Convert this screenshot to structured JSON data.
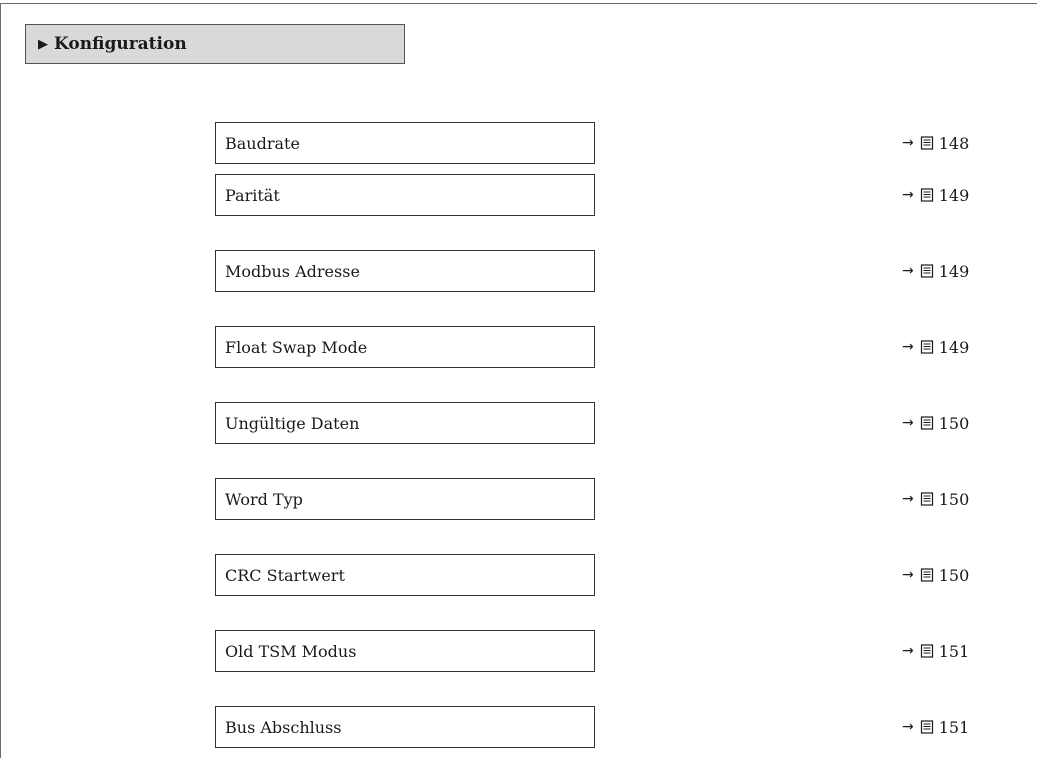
{
  "section": {
    "title": "Konfiguration",
    "expand_icon": "right-triangle-icon"
  },
  "parameters": [
    {
      "label": "Baudrate",
      "page": "148"
    },
    {
      "label": "Parität",
      "page": "149"
    },
    {
      "label": "Modbus Adresse",
      "page": "149"
    },
    {
      "label": "Float Swap Mode",
      "page": "149"
    },
    {
      "label": "Ungültige Daten",
      "page": "150"
    },
    {
      "label": "Word Typ",
      "page": "150"
    },
    {
      "label": "CRC Startwert",
      "page": "150"
    },
    {
      "label": "Old TSM Modus",
      "page": "151"
    },
    {
      "label": "Bus Abschluss",
      "page": "151"
    }
  ],
  "icons": {
    "reference_arrow": "arrow-right-icon",
    "page_reference": "book-icon"
  },
  "colors": {
    "header_background": "#d9d9d9",
    "border": "#333333"
  }
}
